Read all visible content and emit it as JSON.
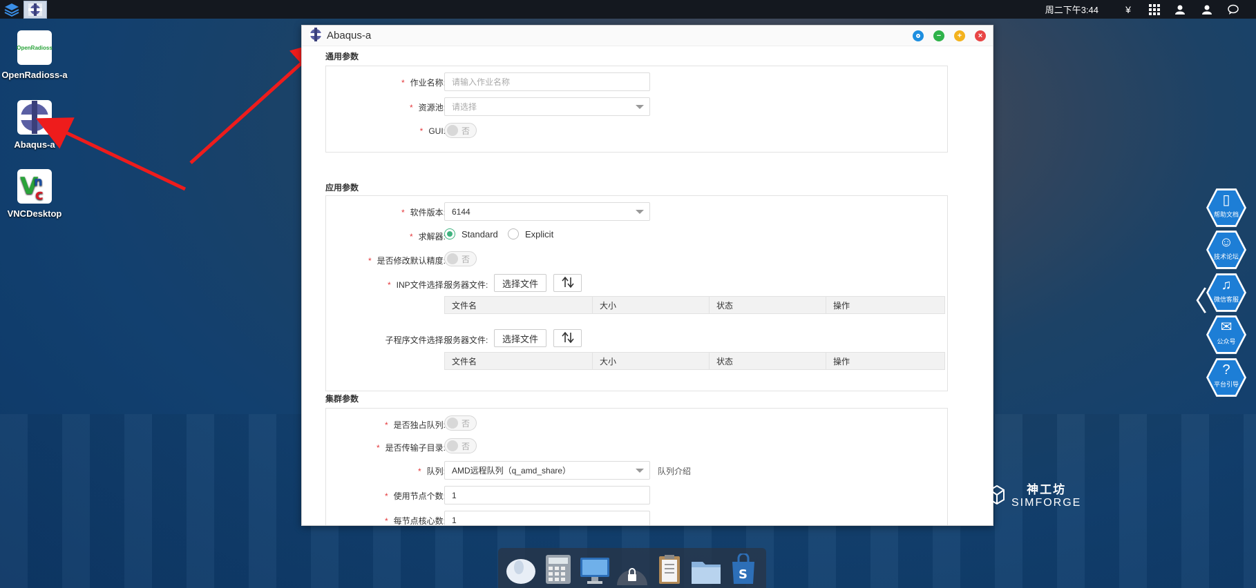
{
  "taskbar": {
    "clock": "周二下午3:44",
    "icons": [
      "app-menu-icon",
      "abaqus-task-icon",
      "currency-icon",
      "grid-icon",
      "user-settings-icon",
      "user-icon",
      "message-icon"
    ]
  },
  "desktop": {
    "icons": [
      {
        "label": "OpenRadioss-a",
        "logo_text": "OpenRadioss"
      },
      {
        "label": "Abaqus-a"
      },
      {
        "label": "VNCDesktop"
      }
    ]
  },
  "window": {
    "title": "Abaqus-a",
    "controls": [
      "target",
      "minimize",
      "maximize",
      "close"
    ],
    "general": {
      "section_title": "通用参数",
      "job_name_label": "作业名称:",
      "job_name_placeholder": "请输入作业名称",
      "pool_label": "资源池:",
      "pool_placeholder": "请选择",
      "gui_label": "GUI:",
      "gui_value": "否"
    },
    "app": {
      "section_title": "应用参数",
      "version_label": "软件版本:",
      "version_value": "6144",
      "solver_label": "求解器:",
      "solver_options": [
        "Standard",
        "Explicit"
      ],
      "solver_selected": "Standard",
      "precision_label": "是否修改默认精度:",
      "precision_value": "否",
      "inp_label": "INP文件选择:",
      "server_file_label": "服务器文件:",
      "choose_file_label": "选择文件",
      "sub_label": "子程序文件选择:",
      "table_headers": [
        "文件名",
        "大小",
        "状态",
        "操作"
      ]
    },
    "cluster": {
      "section_title": "集群参数",
      "exclusive_label": "是否独占队列:",
      "exclusive_value": "否",
      "transfer_label": "是否传输子目录:",
      "transfer_value": "否",
      "queue_label": "队列:",
      "queue_value": "AMD远程队列（q_amd_share）",
      "queue_intro_link": "队列介绍",
      "nodes_label": "使用节点个数:",
      "nodes_value": "1",
      "cores_label": "每节点核心数:",
      "cores_value": "1"
    }
  },
  "side_panel": {
    "items": [
      "帮助文档",
      "技术论坛",
      "微信客服",
      "公众号",
      "平台引导"
    ]
  },
  "brand": {
    "cn": "神工坊",
    "en": "SIMFORGE"
  },
  "dock": {
    "items": [
      "mouse-icon",
      "calculator-icon",
      "monitor-icon",
      "lock-icon",
      "clipboard-icon",
      "folder-icon",
      "store-bag-icon"
    ]
  },
  "colors": {
    "required": "#e4393c",
    "radio_active": "#3fb27f",
    "side_button": "#1d7ed6",
    "annotation_arrow": "#ee1c1c"
  }
}
